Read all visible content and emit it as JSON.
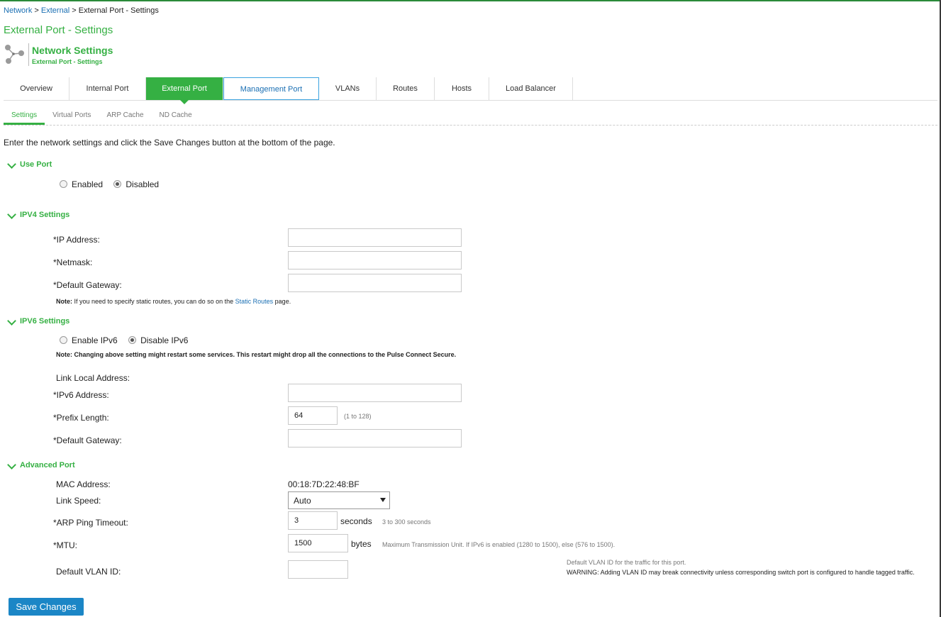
{
  "breadcrumb": {
    "network": "Network",
    "sep1": " > ",
    "external": "External",
    "sep2": " > ",
    "current": "External Port - Settings"
  },
  "page_title": "External Port - Settings",
  "section_header": {
    "title": "Network Settings",
    "subtitle": "External Port - Settings",
    "icon": "network-nodes-icon"
  },
  "tabs": [
    {
      "label": "Overview"
    },
    {
      "label": "Internal Port"
    },
    {
      "label": "External Port",
      "active": true
    },
    {
      "label": "Management Port",
      "hover": true
    },
    {
      "label": "VLANs"
    },
    {
      "label": "Routes"
    },
    {
      "label": "Hosts"
    },
    {
      "label": "Load Balancer"
    }
  ],
  "subtabs": [
    {
      "label": "Settings",
      "active": true
    },
    {
      "label": "Virtual Ports"
    },
    {
      "label": "ARP Cache"
    },
    {
      "label": "ND Cache"
    }
  ],
  "intro": "Enter the network settings and click the Save Changes button at the bottom of the page.",
  "use_port": {
    "title": "Use Port",
    "enabled_label": "Enabled",
    "disabled_label": "Disabled",
    "selected": "Disabled"
  },
  "ipv4": {
    "title": "IPV4 Settings",
    "ip_label": "*IP Address:",
    "ip_value": "",
    "netmask_label": "*Netmask:",
    "netmask_value": "",
    "gateway_label": "*Default Gateway:",
    "gateway_value": "",
    "note_bold": "Note:",
    "note_text": " If you need to specify static routes, you can do so on the ",
    "note_link": "Static Routes",
    "note_end": " page."
  },
  "ipv6": {
    "title": "IPV6 Settings",
    "enable_label": "Enable IPv6",
    "disable_label": "Disable IPv6",
    "selected": "Disable IPv6",
    "note": "Note: Changing above setting might restart some services. This restart might drop all the connections to the Pulse Connect Secure.",
    "link_local_label": "Link Local Address:",
    "address_label": "*IPv6 Address:",
    "address_value": "",
    "prefix_label": "*Prefix Length:",
    "prefix_value": "64",
    "prefix_hint": "(1 to 128)",
    "gateway_label": "*Default Gateway:",
    "gateway_value": ""
  },
  "advanced": {
    "title": "Advanced Port",
    "mac_label": "MAC Address:",
    "mac_value": "00:18:7D:22:48:BF",
    "link_speed_label": "Link Speed:",
    "link_speed_value": "Auto",
    "arp_label": "*ARP Ping Timeout:",
    "arp_value": "3",
    "arp_unit": "seconds",
    "arp_hint": "3 to 300 seconds",
    "mtu_label": "*MTU:",
    "mtu_value": "1500",
    "mtu_unit": "bytes",
    "mtu_hint": "Maximum Transmission Unit. If IPv6 is enabled (1280 to 1500), else (576 to 1500).",
    "vlan_label": "Default VLAN ID:",
    "vlan_value": "",
    "vlan_hint1": "Default VLAN ID for the traffic for this port.",
    "vlan_hint2": "WARNING: Adding VLAN ID may break connectivity unless corresponding switch port is configured to handle tagged traffic."
  },
  "save_button": "Save Changes",
  "colors": {
    "accent": "#35b043",
    "link": "#1a6fb3",
    "button": "#1b86c6"
  }
}
